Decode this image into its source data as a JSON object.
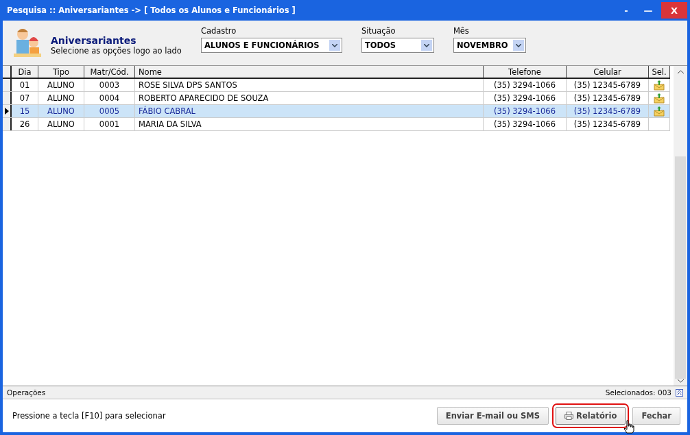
{
  "window": {
    "title": "Pesquisa :: Aniversariantes -> [ Todos os Alunos e Funcionários ]",
    "controls": [
      "-",
      "—",
      "X"
    ]
  },
  "header": {
    "title": "Aniversariantes",
    "subtitle": "Selecione as opções logo ao lado"
  },
  "filters": [
    {
      "label": "Cadastro",
      "value": "ALUNOS E FUNCIONÁRIOS"
    },
    {
      "label": "Situação",
      "value": "TODOS"
    },
    {
      "label": "Mês",
      "value": "NOVEMBRO"
    }
  ],
  "table": {
    "columns": [
      "Dia",
      "Tipo",
      "Matr/Cód.",
      "Nome",
      "Telefone",
      "Celular",
      "Sel."
    ],
    "rows": [
      {
        "cells": [
          "01",
          "ALUNO",
          "0003",
          "ROSE SILVA DPS SANTOS",
          "(35) 3294-1066",
          "(35) 12345-6789"
        ],
        "marked": true,
        "selected": false
      },
      {
        "cells": [
          "07",
          "ALUNO",
          "0004",
          "ROBERTO APARECIDO DE SOUZA",
          "(35) 3294-1066",
          "(35) 12345-6789"
        ],
        "marked": true,
        "selected": false
      },
      {
        "cells": [
          "15",
          "ALUNO",
          "0005",
          "FÁBIO CABRAL",
          "(35) 3294-1066",
          "(35) 12345-6789"
        ],
        "marked": true,
        "selected": true
      },
      {
        "cells": [
          "26",
          "ALUNO",
          "0001",
          "MARIA DA SILVA",
          "(35) 3294-1066",
          "(35) 12345-6789"
        ],
        "marked": false,
        "selected": false
      }
    ]
  },
  "operations": {
    "label": "Operações",
    "count": "Selecionados: 003"
  },
  "footer": {
    "hint": "Pressione a tecla [F10] para selecionar",
    "buttons": [
      {
        "label": "Enviar E-mail ou SMS",
        "icon": false,
        "highlighted": false
      },
      {
        "label": "Relatório",
        "icon": true,
        "highlighted": true
      },
      {
        "label": "Fechar",
        "icon": false,
        "highlighted": false
      }
    ]
  }
}
